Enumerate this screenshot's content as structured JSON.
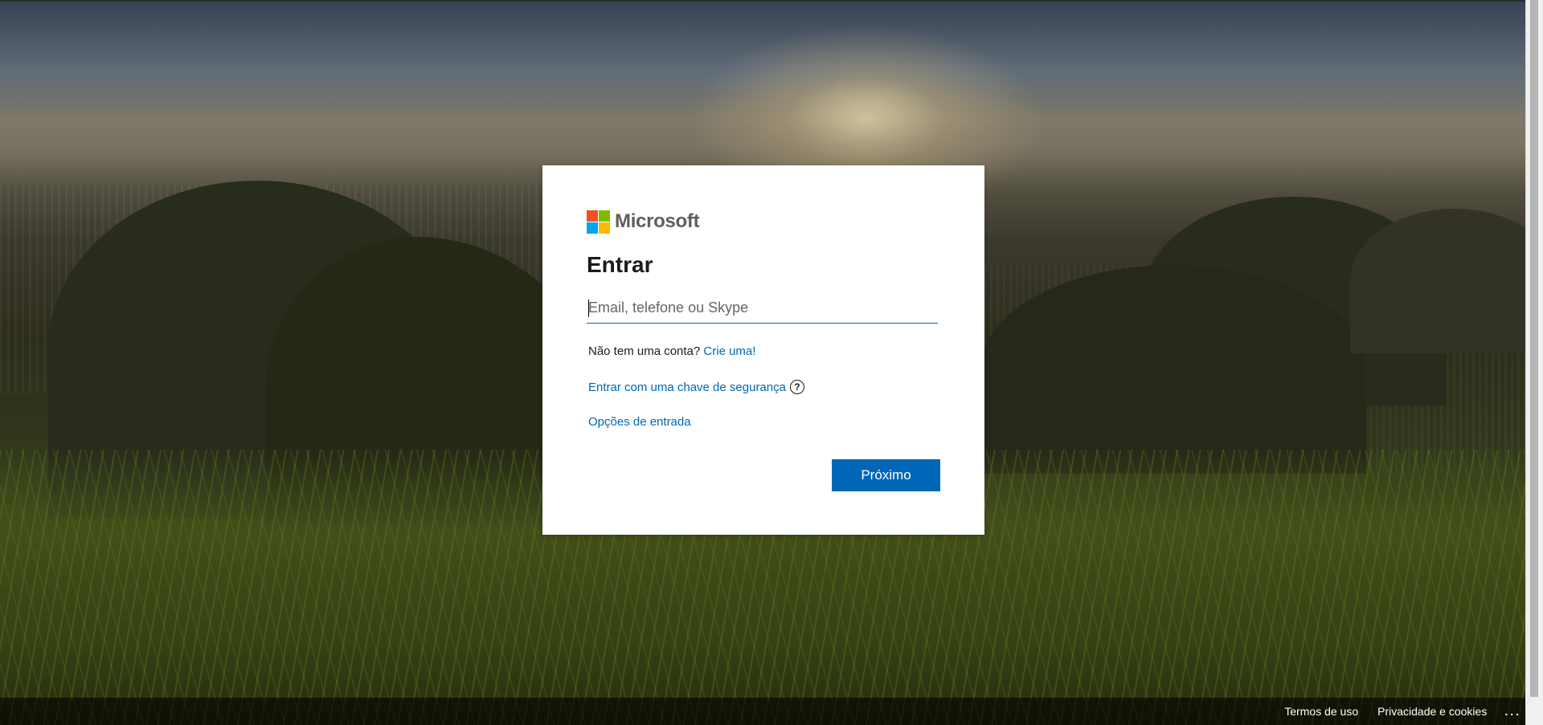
{
  "brand": {
    "name": "Microsoft",
    "logo_colors": [
      "#f25022",
      "#7fba00",
      "#00a4ef",
      "#ffb900"
    ]
  },
  "signin": {
    "title": "Entrar",
    "input_placeholder": "Email, telefone ou Skype",
    "input_value": "",
    "no_account_text": "Não tem uma conta?",
    "create_link": "Crie uma!",
    "security_key_link": "Entrar com uma chave de segurança",
    "help_icon": "?",
    "signin_options_link": "Opções de entrada",
    "next_button": "Próximo"
  },
  "footer": {
    "terms": "Termos de uso",
    "privacy": "Privacidade e cookies",
    "more": "..."
  },
  "colors": {
    "accent": "#0067b8",
    "text": "#1b1b1b"
  }
}
